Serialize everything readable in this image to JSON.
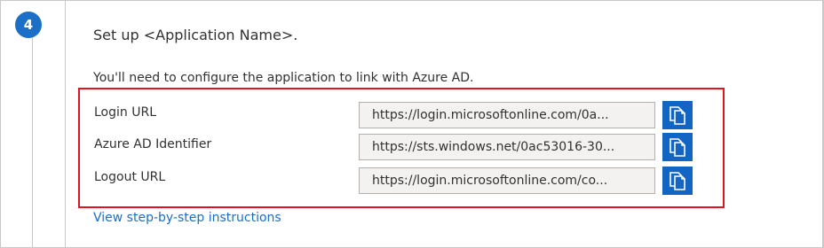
{
  "step": {
    "number": "4"
  },
  "section": {
    "title": "Set up <Application Name>.",
    "description": "You'll need to configure the application to link with Azure AD."
  },
  "fields": [
    {
      "label": "Login URL",
      "value": "https://login.microsoftonline.com/0a..."
    },
    {
      "label": "Azure AD Identifier",
      "value": "https://sts.windows.net/0ac53016-30..."
    },
    {
      "label": "Logout URL",
      "value": "https://login.microsoftonline.com/co..."
    }
  ],
  "instructions_link": "View step-by-step instructions",
  "icons": {
    "copy": "copy-icon"
  },
  "colors": {
    "accent": "#1365c4",
    "highlight": "#e0131f",
    "link": "#1a6ec9"
  }
}
